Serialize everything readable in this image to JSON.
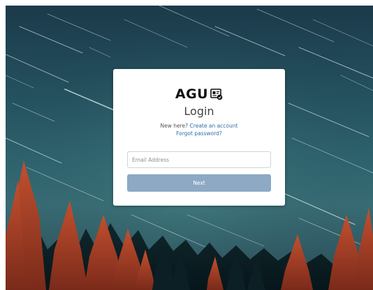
{
  "logo": {
    "text": "AGU",
    "badge_icon": "id-card-check-icon"
  },
  "login": {
    "title": "Login",
    "new_here_prefix": "New here?",
    "create_account_link": "Create an account",
    "forgot_password_link": "Forgot password?",
    "email_placeholder": "Email Address",
    "email_value": "",
    "next_label": "Next"
  },
  "colors": {
    "next_button": "#8da9c4",
    "link": "#2f6ea5",
    "card": "#ffffff",
    "sky": "#24505e",
    "trees": "#b8452c"
  }
}
